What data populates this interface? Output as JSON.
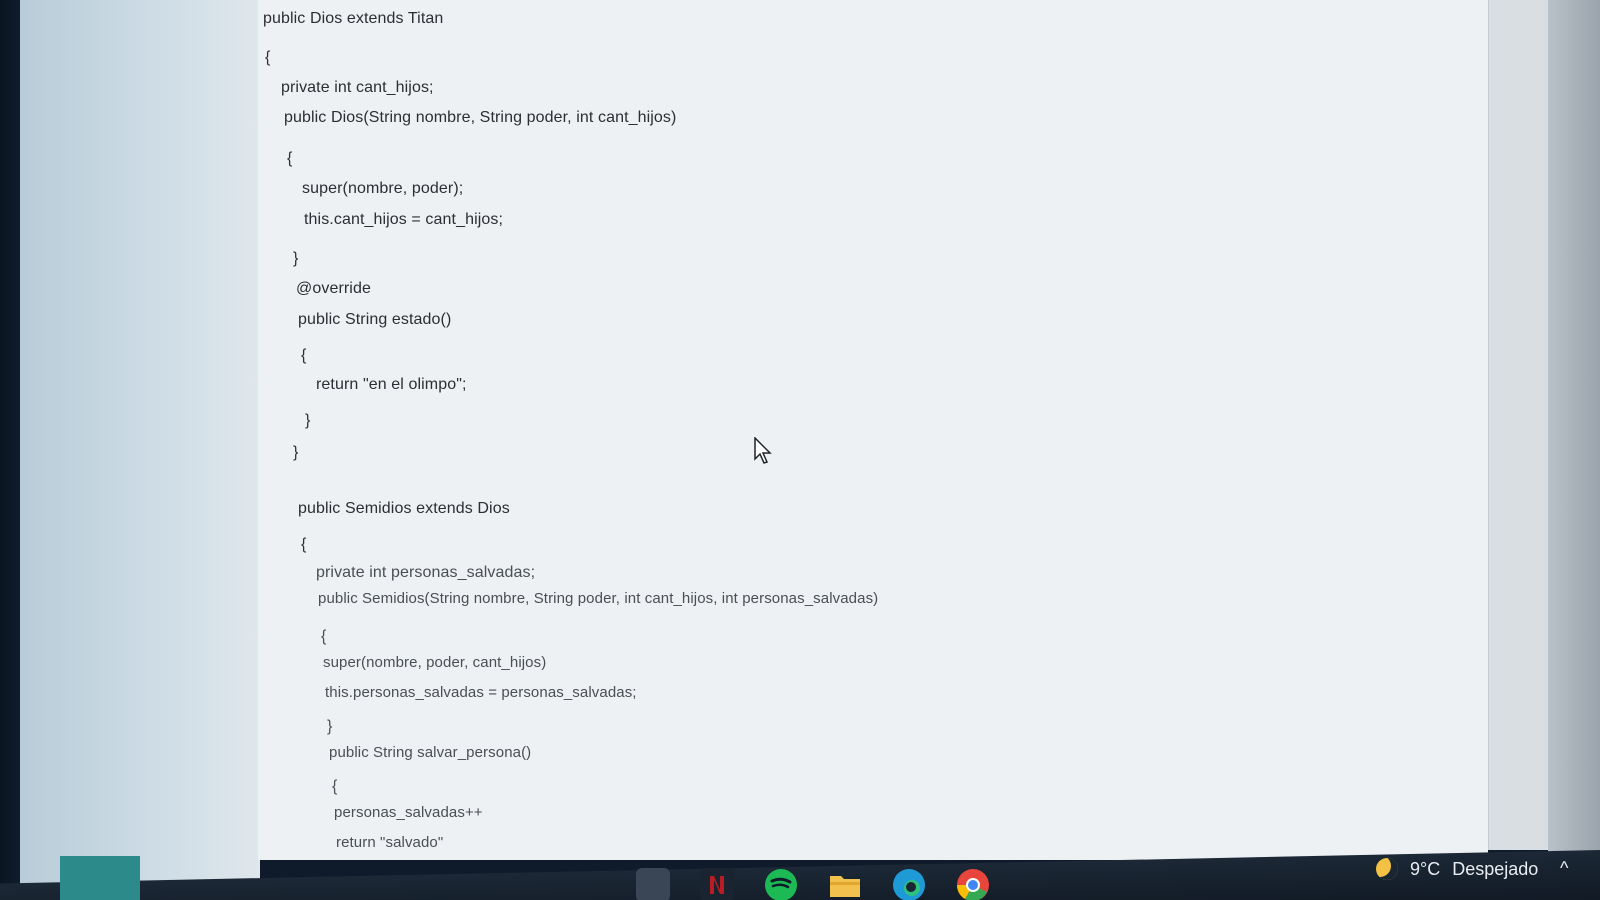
{
  "code": [
    {
      "text": "public Dios extends Titan"
    },
    {
      "text": "{"
    },
    {
      "text": "private int cant_hijos;"
    },
    {
      "text": "public Dios(String nombre, String poder, int cant_hijos)"
    },
    {
      "text": "{"
    },
    {
      "text": "super(nombre, poder);"
    },
    {
      "text": "this.cant_hijos = cant_hijos;"
    },
    {
      "text": "}"
    },
    {
      "text": "@override"
    },
    {
      "text": "public String estado()"
    },
    {
      "text": "{"
    },
    {
      "text": "return \"en el olimpo\";"
    },
    {
      "text": "}"
    },
    {
      "text": "}"
    },
    {
      "text": "public Semidios extends Dios"
    },
    {
      "text": "{"
    },
    {
      "text": "private int personas_salvadas;"
    },
    {
      "text": "public Semidios(String nombre, String poder, int cant_hijos, int personas_salvadas)"
    },
    {
      "text": "{"
    },
    {
      "text": "super(nombre, poder, cant_hijos)"
    },
    {
      "text": "this.personas_salvadas = personas_salvadas;"
    },
    {
      "text": "}"
    },
    {
      "text": "public String salvar_persona()"
    },
    {
      "text": "{"
    },
    {
      "text": "personas_salvadas++"
    },
    {
      "text": "return \"salvado\""
    }
  ],
  "taskbar": {
    "weather_temp": "9°C",
    "weather_condition": "Despejado",
    "weather_icon": "moon-icon",
    "tray_chevron": "^",
    "apps": [
      {
        "name": "taskbar-app-1",
        "icon": "generic-app-icon",
        "color": "#3a4656"
      },
      {
        "name": "taskbar-app-netflix",
        "icon": "netflix-icon",
        "color": "#b81d24"
      },
      {
        "name": "taskbar-app-spotify",
        "icon": "spotify-icon",
        "color": "#1db954"
      },
      {
        "name": "taskbar-app-files",
        "icon": "folder-icon",
        "color": "#f2c14e"
      },
      {
        "name": "taskbar-app-edge",
        "icon": "edge-icon",
        "color": "#1e9ad6"
      },
      {
        "name": "taskbar-app-chrome",
        "icon": "chrome-icon",
        "color": "#e8453c"
      }
    ]
  }
}
